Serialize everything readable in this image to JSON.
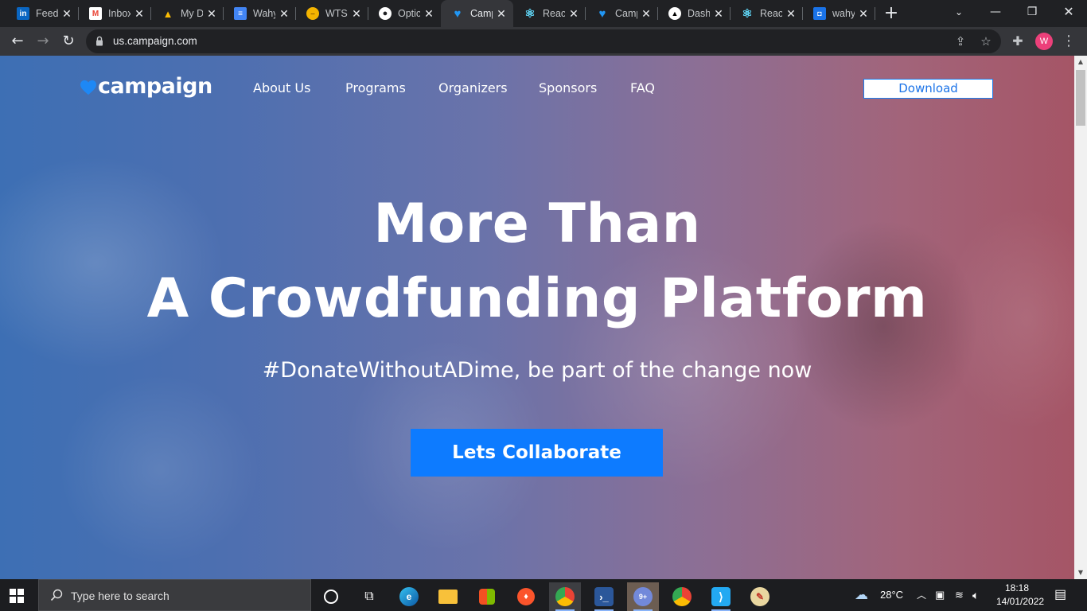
{
  "browser": {
    "tabs": [
      {
        "label": "Feed",
        "favicon": "linkedin-icon",
        "color": "#0a66c2",
        "glyph": "in"
      },
      {
        "label": "Inbox",
        "favicon": "gmail-icon",
        "color": "#ea4335",
        "glyph": "M"
      },
      {
        "label": "My Drive",
        "favicon": "google-drive-icon",
        "color": "#1fa463",
        "glyph": "▲"
      },
      {
        "label": "Wahyu",
        "favicon": "google-docs-icon",
        "color": "#4285f4",
        "glyph": "≡"
      },
      {
        "label": "WTS",
        "favicon": "emoji-icon",
        "color": "#f4b400",
        "glyph": "•"
      },
      {
        "label": "Optic",
        "favicon": "github-icon",
        "color": "#202124",
        "glyph": "●"
      },
      {
        "label": "Campaign",
        "favicon": "heart-icon",
        "color": "#2196f3",
        "glyph": "♥"
      },
      {
        "label": "React",
        "favicon": "react-icon",
        "color": "#35363a",
        "glyph": "⚛"
      },
      {
        "label": "Campaign",
        "favicon": "heart-icon",
        "color": "#2196f3",
        "glyph": "♥"
      },
      {
        "label": "Dashboard",
        "favicon": "vercel-icon",
        "color": "#000000",
        "glyph": "▲"
      },
      {
        "label": "React",
        "favicon": "react-icon",
        "color": "#35363a",
        "glyph": "⚛"
      },
      {
        "label": "wahyu",
        "favicon": "shield-icon",
        "color": "#1a73e8",
        "glyph": "◘"
      }
    ],
    "active_tab": 6,
    "url": "us.campaign.com",
    "profile_initial": "W"
  },
  "site": {
    "logo_text": "campaign",
    "nav": [
      "About Us",
      "Programs",
      "Organizers",
      "Sponsors",
      "FAQ"
    ],
    "download_label": "Download",
    "hero": {
      "title_line1": "More Than",
      "title_line2": "A Crowdfunding Platform",
      "subtitle": "#DonateWithoutADime, be part of the change now",
      "cta_label": "Lets Collaborate"
    },
    "colors": {
      "accent": "#0d7bff",
      "gradient_left": "#3d6fb4",
      "gradient_right": "#a55566"
    }
  },
  "taskbar": {
    "search_placeholder": "Type here to search",
    "weather": "28°C",
    "time": "18:18",
    "date": "14/01/2022",
    "apps": [
      "task-view",
      "edge",
      "file-explorer",
      "store",
      "brave",
      "chrome",
      "powershell",
      "discord",
      "chrome-profile",
      "vscode",
      "paint"
    ]
  }
}
